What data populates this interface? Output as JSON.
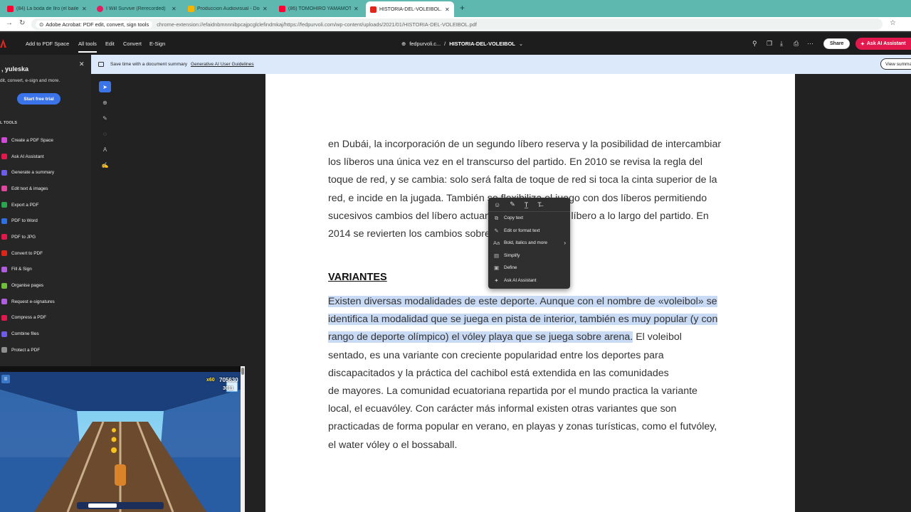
{
  "browser": {
    "tabs": [
      {
        "label": "(84) La boda de Ilro (el baile o...",
        "fav_color": "#ff0033"
      },
      {
        "label": "I Will Survive (Rerecorded)",
        "fav_color": "#e31c5f"
      },
      {
        "label": "Produccion Audiovisual - Docu...",
        "fav_color": "#f4b400"
      },
      {
        "label": "(86) TOMOHIRO YAMAMOTO",
        "fav_color": "#ff0033"
      },
      {
        "label": "HISTORIA-DEL-VOLEIBOL.pdf",
        "fav_color": "#e0261b"
      }
    ],
    "extension_chip": "Adobe Acrobat: PDF edit, convert, sign tools",
    "url": "chrome-extension://efaidnbmnnnibpcajpcglclefindmkaj/https://fedpurvoli.com/wp-content/uploads/2021/01/HISTORIA-DEL-VOLEIBOL.pdf"
  },
  "acrobat": {
    "add_to_space": "Add to PDF Space",
    "menu": [
      "All tools",
      "Edit",
      "Convert",
      "E-Sign"
    ],
    "doc_domain": "fedpurvoli.c...",
    "doc_sep": "/",
    "doc_name": "HISTORIA-DEL-VOLEIBOL",
    "share": "Share",
    "ask_ai": "Ask AI Assistant"
  },
  "panel": {
    "greeting": ", yuleska",
    "subtitle": "dit, convert, e-sign and more.",
    "trial_button": "Start free trial",
    "section": "L TOOLS",
    "tools": [
      {
        "label": "Create a PDF Space",
        "color": "#d24bd8"
      },
      {
        "label": "Ask AI Assistant",
        "color": "#e3194d"
      },
      {
        "label": "Generate a summary",
        "color": "#6c5ce7"
      },
      {
        "label": "Edit text & images",
        "color": "#e0479e"
      },
      {
        "label": "Export a PDF",
        "color": "#2da44e"
      },
      {
        "label": "PDF to Word",
        "color": "#2f6fe4"
      },
      {
        "label": "PDF to JPG",
        "color": "#e3194d"
      },
      {
        "label": "Convert to PDF",
        "color": "#e0261b"
      },
      {
        "label": "Fill & Sign",
        "color": "#b05ddf"
      },
      {
        "label": "Organise pages",
        "color": "#6fbf3a"
      },
      {
        "label": "Request e-signatures",
        "color": "#b05ddf"
      },
      {
        "label": "Compress a PDF",
        "color": "#e3194d"
      },
      {
        "label": "Combine files",
        "color": "#6c5ce7"
      },
      {
        "label": "Protect a PDF",
        "color": "#8e8e8e"
      }
    ]
  },
  "banner": {
    "text": "Save time with a document summary",
    "link": "Generative AI User Guidelines",
    "view_button": "View summary"
  },
  "document": {
    "para1_lines": [
      "en Dubái, la incorporación de un segundo líbero reserva y la posibilidad de intercambiar",
      "los líberos una única vez en el transcurso del partido. En 2010 se revisa la regla del",
      "toque de red, y se cambia: solo será falta de toque de red si toca la cinta superior de la",
      "red, e incide en la jugada. También se flexibiliza el juego con dos líberos permitiendo",
      "sucesivos cambios del líbero actuante por el segundo líbero a lo largo del partido. En",
      "2014 se revierten los cambios sobre el toque de red."
    ],
    "heading": "VARIANTES",
    "para2_highlighted": [
      "Existen diversas modalidades de este deporte. Aunque con el nombre de «voleibol» se",
      "identifica la modalidad que se juega en pista de interior, también es muy popular (y con",
      "rango de deporte olímpico) el vóley playa que se juega sobre arena."
    ],
    "para2_rest_first": " El voleibol",
    "para2_lines": [
      "sentado, es una variante con creciente popularidad entre los deportes para",
      "discapacitados y la práctica del cachibol está extendida en las comunidades",
      "de mayores. La comunidad ecuatoriana repartida por el mundo practica la variante",
      "local, el ecuavóley. Con carácter más informal existen otras variantes que son",
      "practicadas de forma popular en verano, en playas y zonas turísticas, como el futvóley,",
      "el water vóley o el bossaball."
    ]
  },
  "context_menu": {
    "items": [
      {
        "label": "Copy text",
        "icon": "copy-icon"
      },
      {
        "label": "Edit or format text",
        "icon": "edit-icon"
      },
      {
        "label": "Bold, italics and more",
        "icon": "text-style-icon"
      },
      {
        "label": "Simplify",
        "icon": "simplify-icon"
      },
      {
        "label": "Define",
        "icon": "define-icon"
      },
      {
        "label": "Ask AI Assistant",
        "icon": "ai-assistant-icon"
      }
    ]
  },
  "game": {
    "multiplier": "x60",
    "score": "705630",
    "coins": "3011"
  }
}
